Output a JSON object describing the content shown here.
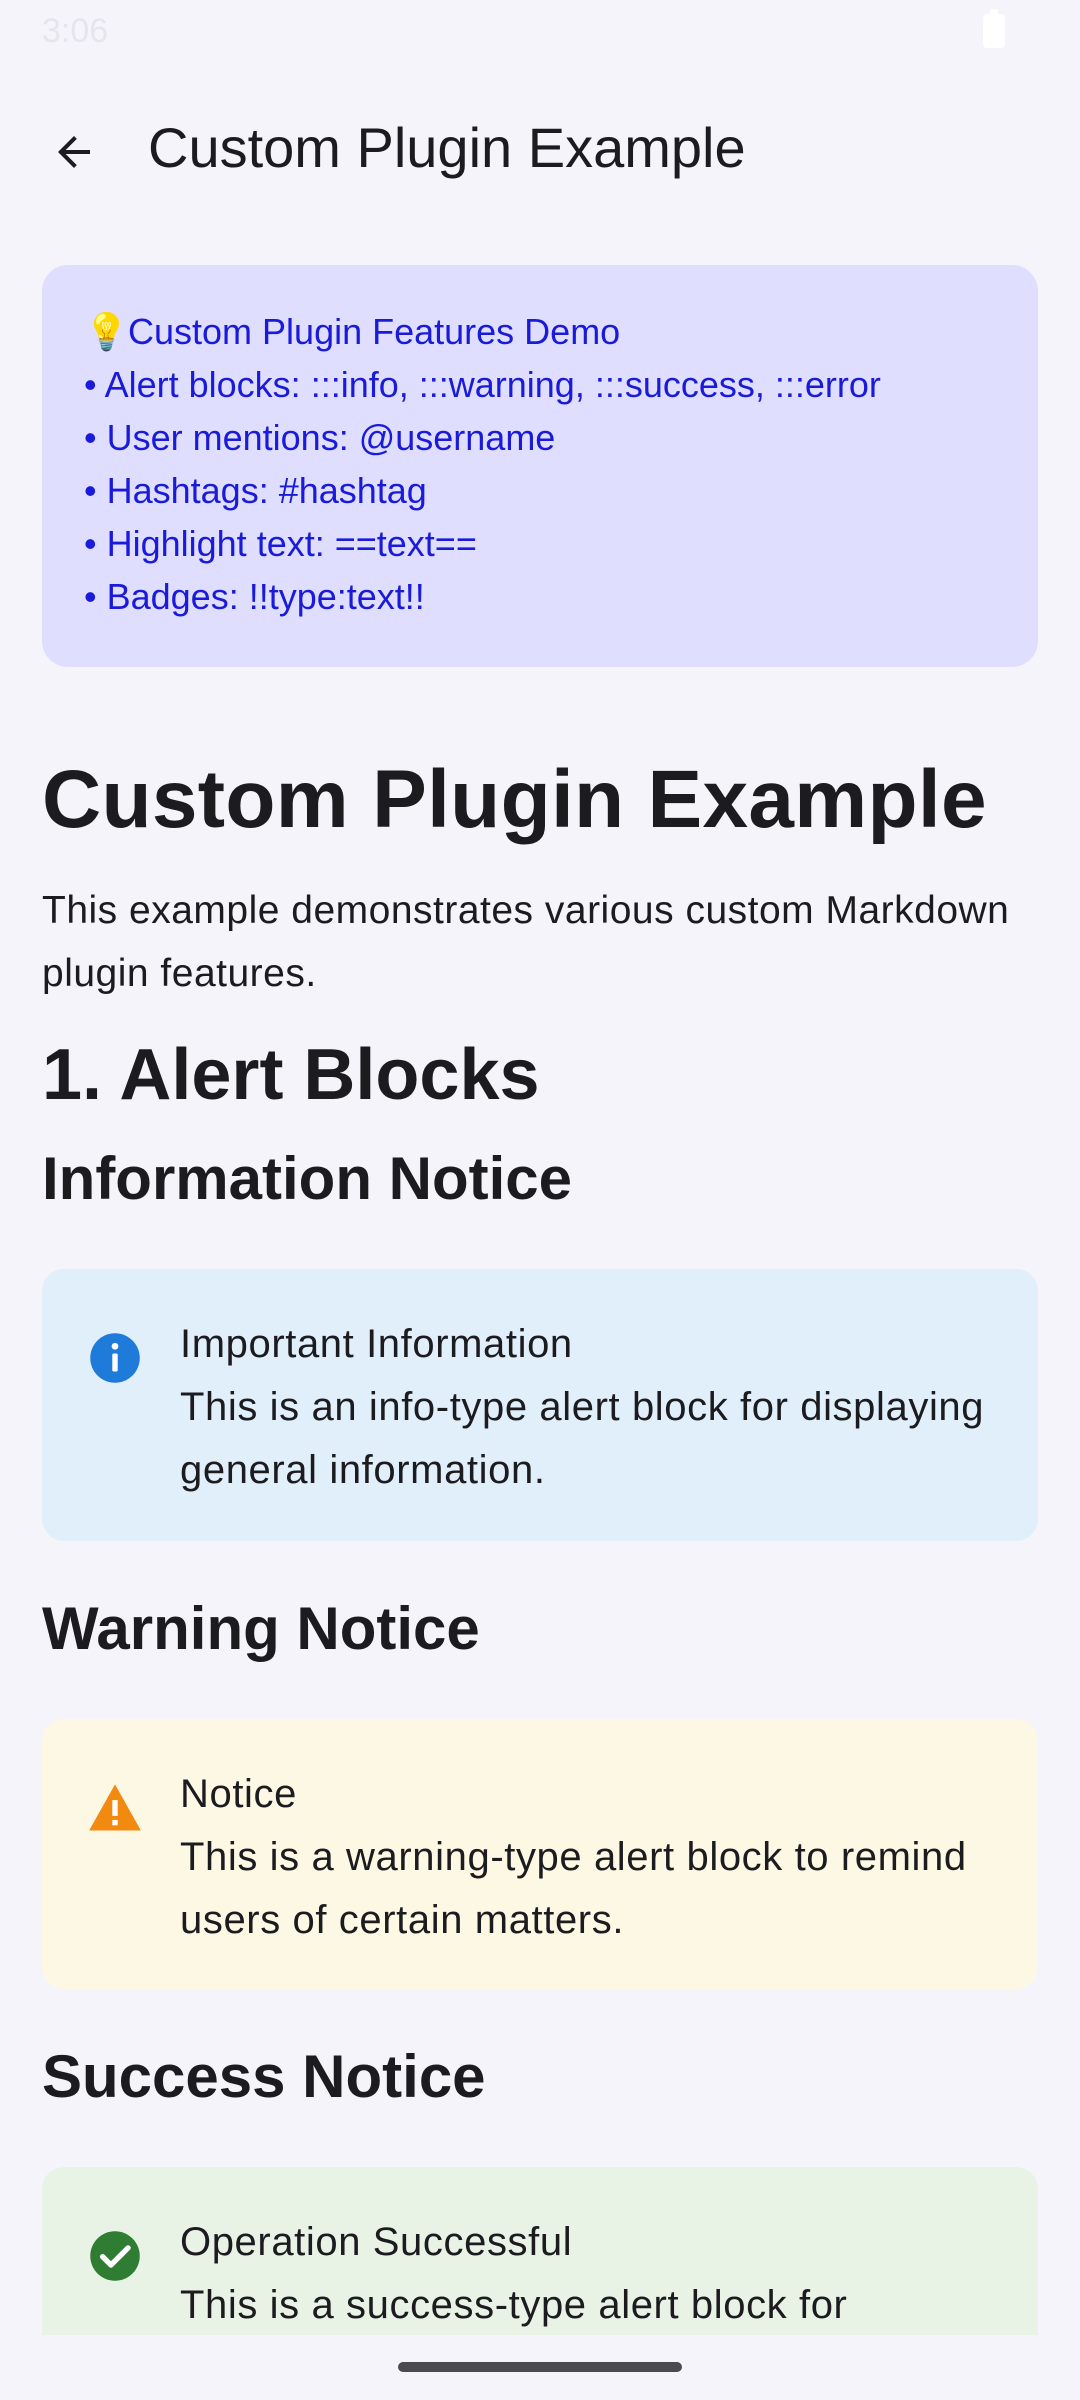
{
  "status_bar": {
    "time": "3:06"
  },
  "app_bar": {
    "title": "Custom Plugin Example",
    "back_icon": "arrow-back-icon"
  },
  "demo_card": {
    "title": "Custom Plugin Features Demo",
    "title_icon": "💡",
    "items": [
      "• Alert blocks: :::info, :::warning, :::success, :::error",
      "• User mentions: @username",
      "• Hashtags: #hashtag",
      "• Highlight text: ==text==",
      "• Badges: !!type:text!!"
    ],
    "bg_color": "#e0deff",
    "text_color": "#1a1ad9"
  },
  "doc": {
    "h1": "Custom Plugin Example",
    "intro": "This example demonstrates various custom Markdown plugin features.",
    "section1": "1. Alert Blocks",
    "info_heading": "Information Notice",
    "info_alert": {
      "title": "Important Information",
      "body": "This is an info-type alert block for displaying general information.",
      "icon": "info-icon",
      "color": "#1e7bd9"
    },
    "warning_heading": "Warning Notice",
    "warning_alert": {
      "title": "Notice",
      "body": "This is a warning-type alert block to remind users of certain matters.",
      "icon": "warning-icon",
      "color": "#f28a0f"
    },
    "success_heading": "Success Notice",
    "success_alert": {
      "title": "Operation Successful",
      "body": "This is a success-type alert block for displaying successful operations.",
      "icon": "check-circle-icon",
      "color": "#2e7d32"
    }
  }
}
